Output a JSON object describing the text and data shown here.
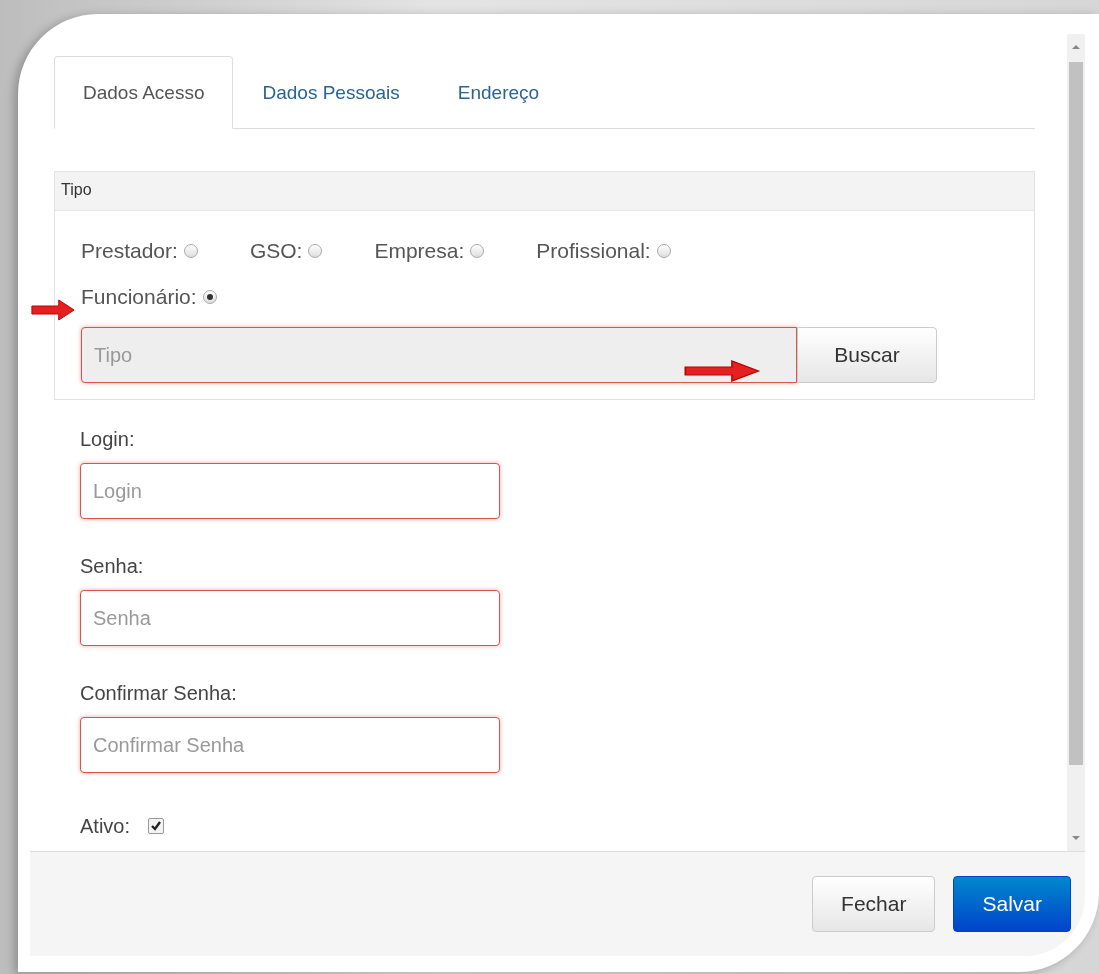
{
  "tabs": [
    {
      "label": "Dados Acesso",
      "selected": true
    },
    {
      "label": "Dados Pessoais",
      "selected": false
    },
    {
      "label": "Endereço",
      "selected": false
    }
  ],
  "tipo_panel": {
    "title": "Tipo",
    "options": [
      {
        "label": "Prestador:",
        "selected": false
      },
      {
        "label": "GSO:",
        "selected": false
      },
      {
        "label": "Empresa:",
        "selected": false
      },
      {
        "label": "Profissional:",
        "selected": false
      },
      {
        "label": "Funcionário:",
        "selected": true
      }
    ],
    "field": {
      "placeholder": "Tipo"
    },
    "button": "Buscar"
  },
  "fields": [
    {
      "label": "Login:",
      "placeholder": "Login"
    },
    {
      "label": "Senha:",
      "placeholder": "Senha"
    },
    {
      "label": "Confirmar Senha:",
      "placeholder": "Confirmar Senha"
    }
  ],
  "ativo": {
    "label": "Ativo:",
    "checked": true
  },
  "buttons": [
    {
      "label": "Fechar",
      "kind": "default"
    },
    {
      "label": "Salvar",
      "kind": "primary"
    }
  ]
}
